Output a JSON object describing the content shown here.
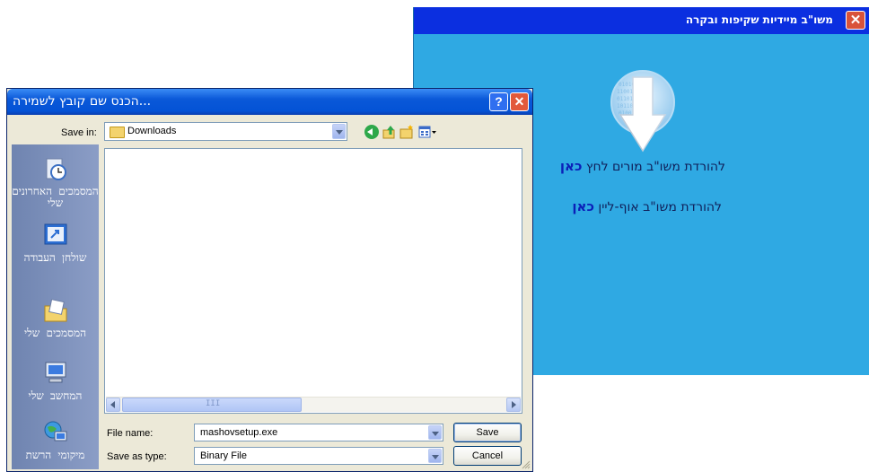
{
  "app_window": {
    "title": "משו\"ב מיידיות שקיפות ובקרה",
    "close_glyph": "✕",
    "line1_text": "להורדת משו\"ב מורים לחץ ",
    "line1_link": "כאן",
    "line2_text": "להורדת משו\"ב אוף-ליין ",
    "line2_link": "כאן",
    "icons": {
      "download": "download-arrow-icon",
      "close": "close-icon"
    },
    "colors": {
      "background": "#2fa9e3",
      "titlebar": "#0b2fe0"
    }
  },
  "save_dialog": {
    "title": "...הכנס שם קובץ לשמירה",
    "help_glyph": "?",
    "close_glyph": "✕",
    "save_in_label": "Save in:",
    "save_in_value": "Downloads",
    "scroll_thumb_grip": "III",
    "places": [
      {
        "label": "המסמכים האחרונים שלי",
        "icon": "recent-documents-icon"
      },
      {
        "label": "שולחן העבודה",
        "icon": "desktop-icon"
      },
      {
        "label": "המסמכים שלי",
        "icon": "my-documents-icon"
      },
      {
        "label": "המחשב שלי",
        "icon": "my-computer-icon"
      },
      {
        "label": "מיקומי הרשת",
        "icon": "network-places-icon"
      }
    ],
    "file_name_label": "File name:",
    "file_name_value": "mashovsetup.exe",
    "save_as_type_label": "Save as type:",
    "save_as_type_value": "Binary File",
    "save_button": "Save",
    "cancel_button": "Cancel",
    "colors": {
      "titlebar": "#0453d6",
      "body": "#ece9d8",
      "places_bar": "#7a8fb8"
    }
  }
}
